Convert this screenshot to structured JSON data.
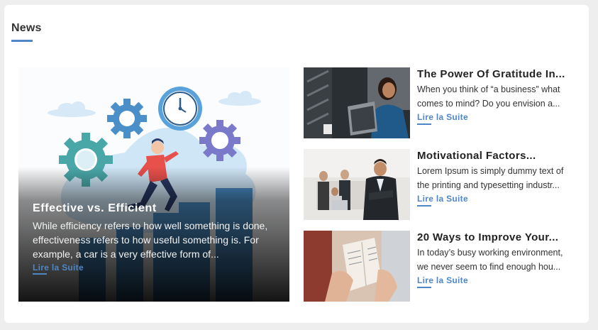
{
  "section": {
    "title": "News"
  },
  "featured": {
    "title": "Effective vs. Efficient",
    "excerpt": "While efficiency refers to how well something is done, effectiveness refers to how useful something is. For example, a car is a very effective form of...",
    "link": "Lire la Suite"
  },
  "articles": [
    {
      "title": "The Power Of Gratitude In...",
      "excerpt_lines": [
        "When you think of “a business” what",
        "comes to mind? Do you envision a..."
      ],
      "link": "Lire la Suite"
    },
    {
      "title": "Motivational Factors...",
      "excerpt_lines": [
        "Lorem Ipsum is simply dummy text of",
        "the printing and typesetting industr..."
      ],
      "link": "Lire la Suite"
    },
    {
      "title": "20 Ways to Improve Your...",
      "excerpt_lines": [
        "In today’s busy working environment,",
        "we never seem to find enough hou..."
      ],
      "link": "Lire la Suite"
    }
  ],
  "colors": {
    "accent": "#4f86c6",
    "card": "#ffffff",
    "background": "#eeeeee"
  }
}
